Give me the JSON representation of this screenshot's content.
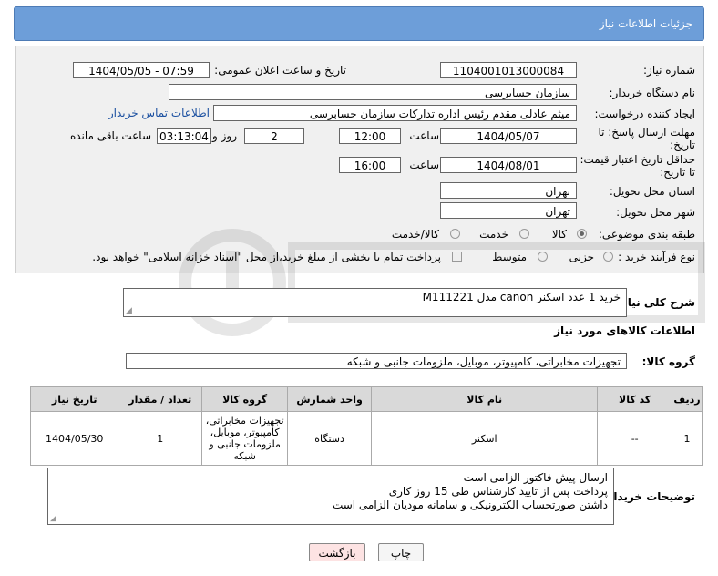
{
  "header": {
    "title": "جزئیات اطلاعات نیاز"
  },
  "form": {
    "need_number_label": "شماره نیاز:",
    "need_number": "1104001013000084",
    "announce_label": "تاریخ و ساعت اعلان عمومی:",
    "announce_value": "1404/05/05 - 07:59",
    "buyer_org_label": "نام دستگاه خریدار:",
    "buyer_org": "سازمان حسابرسی",
    "requester_label": "ایجاد کننده درخواست:",
    "requester": "میثم عادلی مقدم رئیس اداره تدارکات سازمان حسابرسی",
    "contact_link": "اطلاعات تماس خریدار",
    "reply_deadline_label": "مهلت ارسال پاسخ: تا تاریخ:",
    "reply_date": "1404/05/07",
    "time_label": "ساعت",
    "reply_time": "12:00",
    "days_value": "2",
    "days_label": "روز و",
    "remaining_value": "03:13:04",
    "remaining_label": "ساعت باقی مانده",
    "price_validity_label": "حداقل تاریخ اعتبار قیمت: تا تاریخ:",
    "price_date": "1404/08/01",
    "price_time": "16:00",
    "province_label": "استان محل تحویل:",
    "province": "تهران",
    "city_label": "شهر محل تحویل:",
    "city": "تهران",
    "category_label": "طبقه بندی موضوعی:",
    "category_options": [
      "کالا",
      "خدمت",
      "کالا/خدمت"
    ],
    "process_label": "نوع فرآیند خرید :",
    "process_options": [
      "جزیی",
      "متوسط"
    ],
    "payment_note": "پرداخت تمام یا بخشی از مبلغ خرید،از محل \"اسناد خزانه اسلامی\" خواهد بود."
  },
  "description": {
    "label": "شرح کلی نیاز:",
    "value": "خرید 1 عدد اسکنر canon مدل M111221"
  },
  "goods_info_title": "اطلاعات کالاهای مورد نیاز",
  "goods_group": {
    "label": "گروه کالا:",
    "value": "تجهیزات مخابراتی، کامپیوتر، موبایل، ملزومات جانبی و شبکه"
  },
  "table": {
    "headers": [
      "ردیف",
      "کد کالا",
      "نام کالا",
      "واحد شمارش",
      "گروه کالا",
      "تعداد / مقدار",
      "تاریخ نیاز"
    ],
    "rows": [
      [
        "1",
        "--",
        "اسکنر",
        "دستگاه",
        "تجهیزات مخابراتی، کامپیوتر، موبایل، ملزومات جانبی و شبکه",
        "1",
        "1404/05/30"
      ]
    ]
  },
  "buyer_notes": {
    "label": "توضیحات خریدار:",
    "lines": [
      "ارسال پیش فاکتور الزامی است",
      "پرداخت پس از تایید کارشناس طی 15 روز کاری",
      "داشتن صورتحساب الکترونیکی و سامانه مودیان الزامی است"
    ]
  },
  "buttons": {
    "print": "چاپ",
    "back": "بازگشت"
  },
  "colors": {
    "header_bg": "#6d9ed9",
    "link": "#1a4fa0",
    "back_button_bg": "#fde3e3"
  }
}
